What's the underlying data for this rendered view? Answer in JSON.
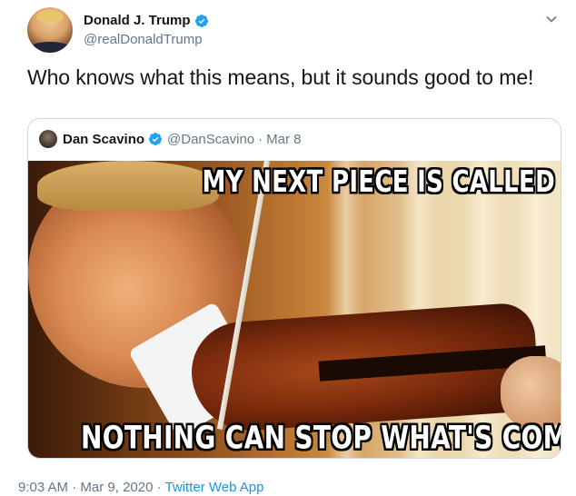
{
  "author": {
    "display_name": "Donald J. Trump",
    "handle": "@realDonaldTrump"
  },
  "tweet": {
    "text": "Who knows what this means, but it sounds good to me!"
  },
  "quoted_tweet": {
    "display_name": "Dan Scavino",
    "handle": "@DanScavino",
    "separator": "·",
    "date": "Mar 8",
    "meme_top_text": "MY NEXT PIECE IS CALLED",
    "meme_bottom_text": "NOTHING CAN STOP WHAT'S COMING"
  },
  "meta": {
    "time": "9:03 AM",
    "separator": "·",
    "date": "Mar 9, 2020",
    "source": "Twitter Web App"
  },
  "colors": {
    "verified": "#1da1f2",
    "secondary_text": "#657786",
    "link": "#1b95e0"
  },
  "icons": [
    "verified-badge-icon",
    "chevron-down-icon"
  ]
}
